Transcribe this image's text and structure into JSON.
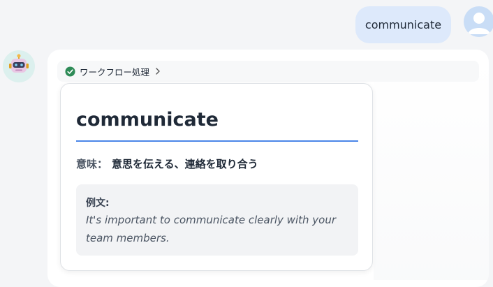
{
  "user_message": {
    "text": "communicate",
    "avatar_icon": "user-avatar-icon"
  },
  "bot": {
    "avatar_icon": "robot-avatar-icon",
    "workflow": {
      "label": "ワークフロー処理",
      "status_icon": "check-circle-icon",
      "status_color": "#2e8b57",
      "expand_icon": "chevron-right-icon"
    },
    "card": {
      "word": "communicate",
      "meaning_label": "意味：",
      "meaning": "意思を伝える、連絡を取り合う",
      "example_label": "例文:",
      "example": "It's important to communicate clearly with your team members."
    }
  },
  "colors": {
    "accent": "#4a86e8",
    "user_bubble": "#dde9fb",
    "page_bg": "#f4f5f7"
  }
}
